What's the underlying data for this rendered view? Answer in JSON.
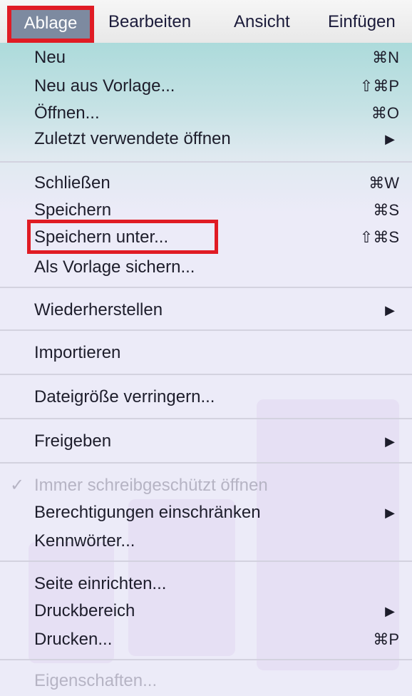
{
  "menubar": {
    "items": [
      "Ablage",
      "Bearbeiten",
      "Ansicht",
      "Einfügen"
    ],
    "active": "Ablage"
  },
  "menu": {
    "items": [
      {
        "label": "Neu",
        "shortcut": "⌘N"
      },
      {
        "label": "Neu aus Vorlage...",
        "shortcut": "⇧⌘P"
      },
      {
        "label": "Öffnen...",
        "shortcut": "⌘O"
      },
      {
        "label": "Zuletzt verwendete öffnen",
        "submenu_arrow": "▶"
      },
      {
        "label": "Schließen",
        "shortcut": "⌘W"
      },
      {
        "label": "Speichern",
        "shortcut": "⌘S"
      },
      {
        "label": "Speichern unter...",
        "shortcut": "⇧⌘S"
      },
      {
        "label": "Als Vorlage sichern..."
      },
      {
        "label": "Wiederherstellen",
        "submenu_arrow": "▶"
      },
      {
        "label": "Importieren"
      },
      {
        "label": "Dateigröße verringern..."
      },
      {
        "label": "Freigeben",
        "submenu_arrow": "▶"
      },
      {
        "label": "Immer schreibgeschützt öffnen",
        "checkmark": "✓",
        "disabled": true
      },
      {
        "label": "Berechtigungen einschränken",
        "submenu_arrow": "▶"
      },
      {
        "label": "Kennwörter..."
      },
      {
        "label": "Seite einrichten..."
      },
      {
        "label": "Druckbereich",
        "submenu_arrow": "▶"
      },
      {
        "label": "Drucken...",
        "shortcut": "⌘P"
      },
      {
        "label": "Eigenschaften...",
        "disabled": true
      }
    ]
  },
  "colors": {
    "highlight_border": "#e01b24",
    "menu_background": "#ecebf8",
    "active_menu_bg": "#7d8aa0",
    "disabled_text": "#b6b4c4"
  }
}
